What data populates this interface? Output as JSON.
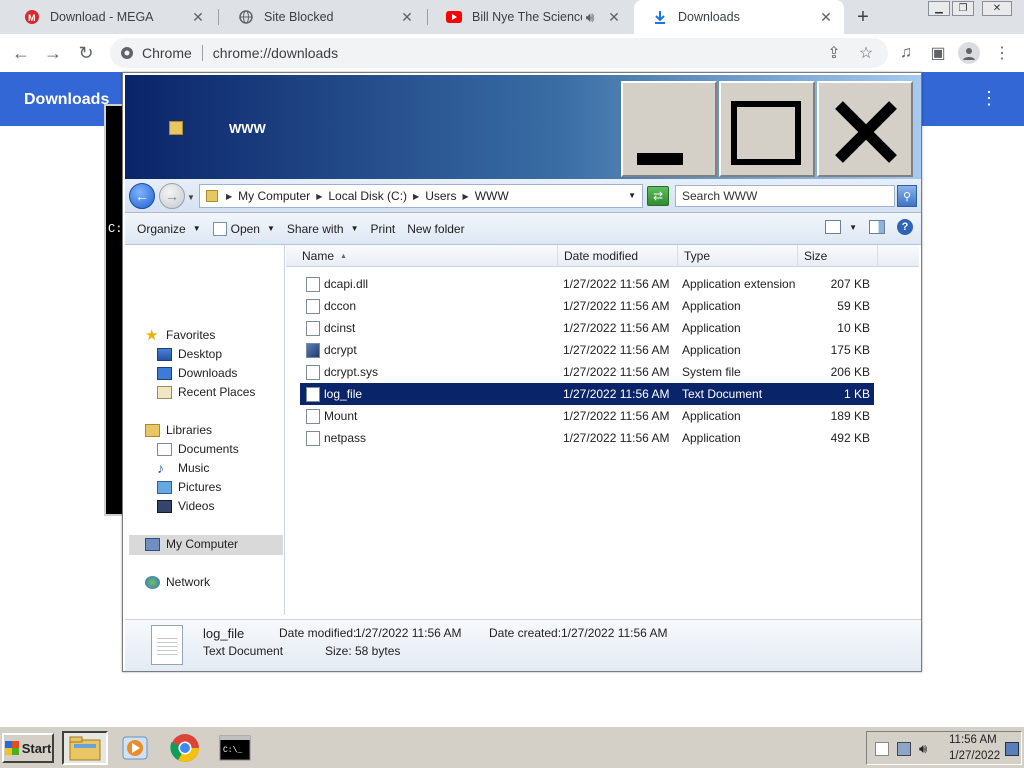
{
  "browser": {
    "tabs": [
      {
        "label": "Download - MEGA"
      },
      {
        "label": "Site Blocked"
      },
      {
        "label": "Bill Nye The Science Guy"
      },
      {
        "label": "Downloads"
      }
    ],
    "omnibox": {
      "chip": "Chrome",
      "url": "chrome://downloads"
    }
  },
  "downloads_page": {
    "title": "Downloads"
  },
  "console": {
    "visible_text": "C:"
  },
  "explorer": {
    "title": "WWW",
    "breadcrumb": [
      "My Computer",
      "Local Disk (C:)",
      "Users",
      "WWW"
    ],
    "search_placeholder": "Search WWW",
    "commands": {
      "organize": "Organize",
      "open": "Open",
      "share_with": "Share with",
      "print": "Print",
      "new_folder": "New folder"
    },
    "nav": {
      "favorites": "Favorites",
      "desktop": "Desktop",
      "downloads": "Downloads",
      "recent_places": "Recent Places",
      "libraries": "Libraries",
      "documents": "Documents",
      "music": "Music",
      "pictures": "Pictures",
      "videos": "Videos",
      "my_computer": "My Computer",
      "network": "Network"
    },
    "columns": {
      "name": "Name",
      "date_modified": "Date modified",
      "type": "Type",
      "size": "Size"
    },
    "files": [
      {
        "name": "dcapi.dll",
        "date": "1/27/2022 11:56 AM",
        "type": "Application extension",
        "size": "207 KB"
      },
      {
        "name": "dccon",
        "date": "1/27/2022 11:56 AM",
        "type": "Application",
        "size": "59 KB"
      },
      {
        "name": "dcinst",
        "date": "1/27/2022 11:56 AM",
        "type": "Application",
        "size": "10 KB"
      },
      {
        "name": "dcrypt",
        "date": "1/27/2022 11:56 AM",
        "type": "Application",
        "size": "175 KB"
      },
      {
        "name": "dcrypt.sys",
        "date": "1/27/2022 11:56 AM",
        "type": "System file",
        "size": "206 KB"
      },
      {
        "name": "log_file",
        "date": "1/27/2022 11:56 AM",
        "type": "Text Document",
        "size": "1 KB"
      },
      {
        "name": "Mount",
        "date": "1/27/2022 11:56 AM",
        "type": "Application",
        "size": "189 KB"
      },
      {
        "name": "netpass",
        "date": "1/27/2022 11:56 AM",
        "type": "Application",
        "size": "492 KB"
      }
    ],
    "selected_file": "log_file",
    "details": {
      "name": "log_file",
      "type": "Text Document",
      "date_modified_label": "Date modified:",
      "date_modified": "1/27/2022 11:56 AM",
      "date_created_label": "Date created:",
      "date_created": "1/27/2022 11:56 AM",
      "size_label": "Size:",
      "size": "58 bytes"
    }
  },
  "taskbar": {
    "start_label": "Start",
    "clock_time": "11:56 AM",
    "clock_date": "1/27/2022"
  },
  "colors": {
    "chrome_header": "#3367d6",
    "selection": "#0a246a",
    "title_gradient_start": "#0a246a",
    "taskbar": "#d4d0c8"
  }
}
